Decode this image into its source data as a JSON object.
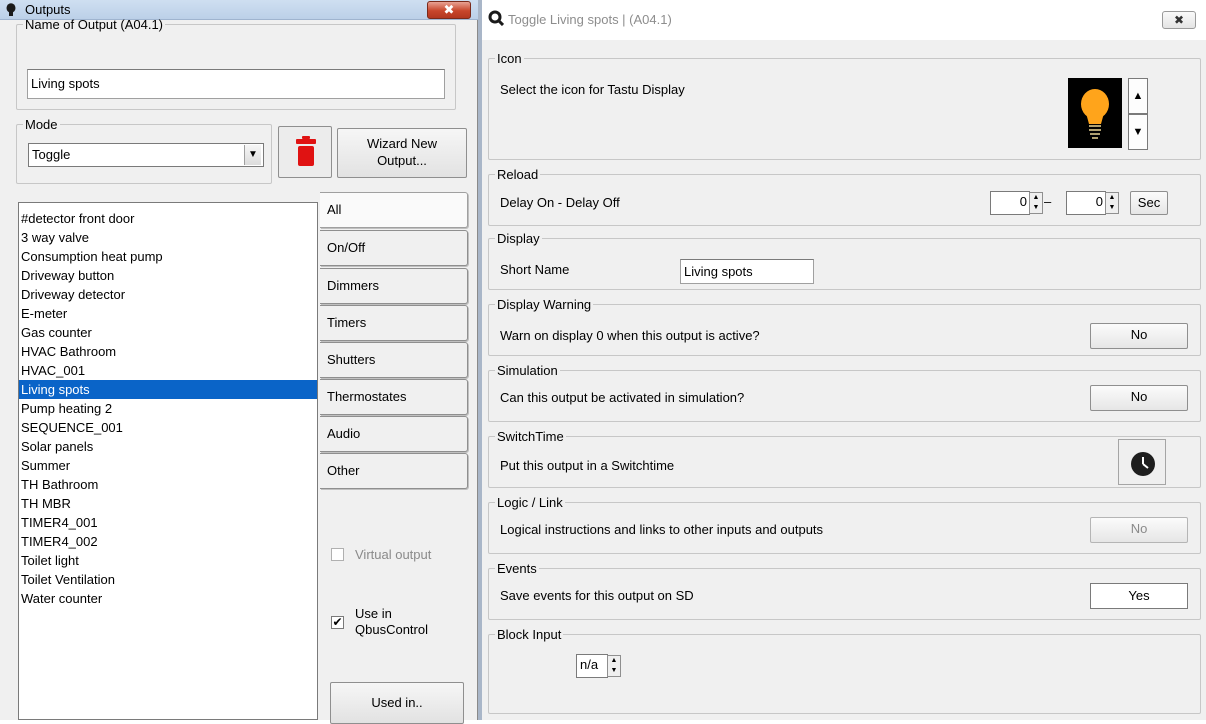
{
  "left_window": {
    "title": "Outputs",
    "close_label": "✖",
    "name_group": {
      "legend": "Name of Output (A04.1)",
      "value": "Living spots"
    },
    "mode_group": {
      "legend": "Mode",
      "selected": "Toggle"
    },
    "wizard_button": {
      "line1": "Wizard New",
      "line2": "Output..."
    },
    "outputs": [
      "#detector front door",
      "3 way valve",
      "Consumption heat pump",
      "Driveway button",
      "Driveway detector",
      "E-meter",
      "Gas counter",
      "HVAC Bathroom",
      "HVAC_001",
      "Living spots",
      "Pump heating 2",
      "SEQUENCE_001",
      "Solar panels",
      "Summer",
      "TH Bathroom",
      "TH MBR",
      "TIMER4_001",
      "TIMER4_002",
      "Toilet light",
      "Toilet Ventilation",
      "Water counter"
    ],
    "selected_output": "Living spots",
    "tabs": [
      "All",
      "On/Off",
      "Dimmers",
      "Timers",
      "Shutters",
      "Thermostates",
      "Audio",
      "Other"
    ],
    "active_tab": "All",
    "virtual_output": {
      "label": "Virtual output",
      "checked": false,
      "enabled": false
    },
    "use_in": {
      "line1": "Use in",
      "line2": "QbusControl",
      "checked": true
    },
    "used_in_button": "Used in.."
  },
  "right_window": {
    "title": "Toggle Living spots |  (A04.1)",
    "close_label": "✖",
    "icon": {
      "legend": "Icon",
      "description": "Select the icon for Tastu Display",
      "icon_name": "lightbulb-icon"
    },
    "reload": {
      "legend": "Reload",
      "description": "Delay On - Delay Off",
      "delay_on": "0",
      "delay_off": "0",
      "separator": "–",
      "unit_button": "Sec"
    },
    "display": {
      "legend": "Display",
      "label": "Short Name",
      "value": "Living spots"
    },
    "display_warning": {
      "legend": "Display Warning",
      "description": "Warn on display 0 when this output is active?",
      "button": "No"
    },
    "simulation": {
      "legend": "Simulation",
      "description": "Can this output be activated in simulation?",
      "button": "No"
    },
    "switchtime": {
      "legend": "SwitchTime",
      "description": "Put this output in a Switchtime",
      "icon_name": "clock-icon"
    },
    "logic_link": {
      "legend": "Logic / Link",
      "description": "Logical instructions and links to other inputs and outputs",
      "button": "No"
    },
    "events": {
      "legend": "Events",
      "description": "Save events for this output on SD",
      "button": "Yes"
    },
    "block_input": {
      "legend": "Block Input",
      "value": "n/a"
    }
  },
  "colors": {
    "selection": "#0a64c8",
    "close_red": "#c8462b",
    "bulb": "#ffa41b"
  }
}
